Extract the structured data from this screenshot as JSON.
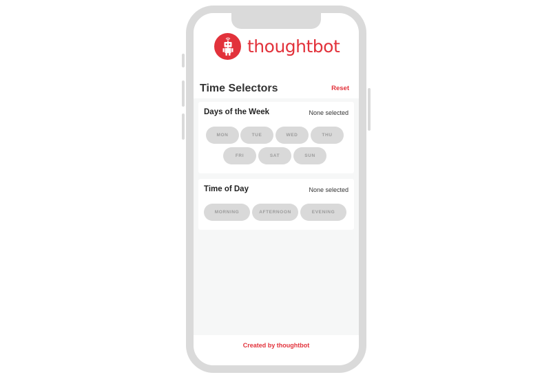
{
  "brand": {
    "name": "thoughtbot",
    "color": "#e2323b",
    "logo_icon": "robot-icon"
  },
  "header": {
    "title": "Time Selectors",
    "reset_label": "Reset"
  },
  "days_section": {
    "title": "Days of the Week",
    "status": "None selected",
    "options": [
      "MON",
      "TUE",
      "WED",
      "THU",
      "FRI",
      "SAT",
      "SUN"
    ]
  },
  "time_section": {
    "title": "Time of Day",
    "status": "None selected",
    "options": [
      "MORNING",
      "AFTERNOON",
      "EVENING"
    ]
  },
  "footer": {
    "text": "Created by thoughtbot"
  }
}
